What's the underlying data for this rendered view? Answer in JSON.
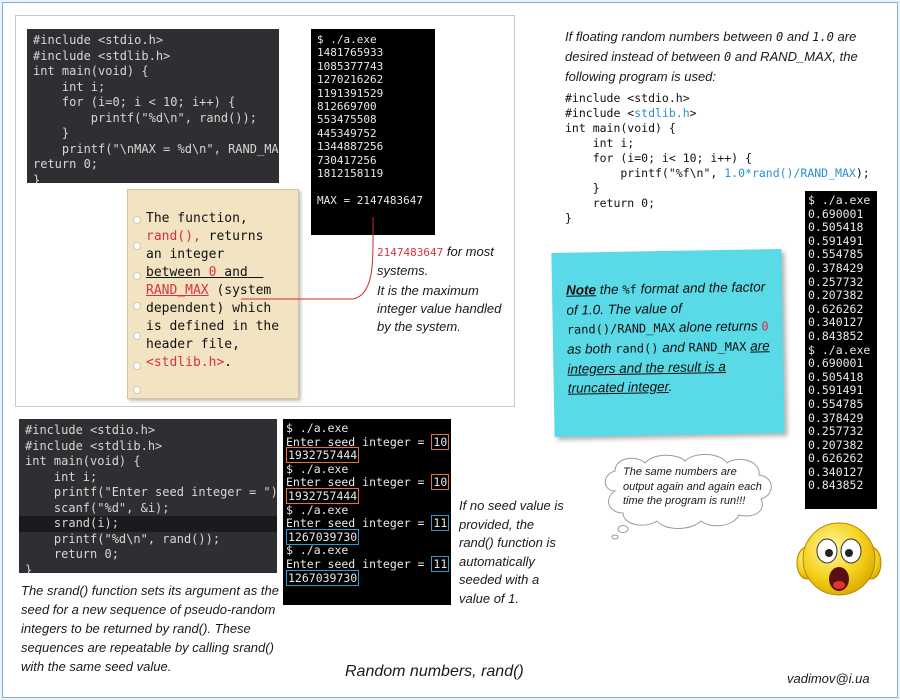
{
  "code1": {
    "lines": [
      "#include <stdio.h>",
      "#include <stdlib.h>",
      "int main(void) {",
      "    int i;",
      "    for (i=0; i < 10; i++) {",
      "        printf(\"%d\\n\", rand());",
      "    }",
      "    printf(\"\\nMAX = %d\\n\", RAND_MAX);",
      "return 0;",
      "}"
    ]
  },
  "term1": {
    "lines": [
      "$ ./a.exe",
      "1481765933",
      "1085377743",
      "1270216262",
      "1191391529",
      "812669700",
      "553475508",
      "445349752",
      "1344887256",
      "730417256",
      "1812158119",
      "",
      "MAX = 2147483647"
    ]
  },
  "note1": {
    "p1": "The function,",
    "p2": "rand(),",
    "p3": "returns",
    "p4": "an integer",
    "p5": "between",
    "p6": "0",
    "p7": "and",
    "p8": "RAND_MAX",
    "p9": "(system",
    "p10": "dependent) which",
    "p11": "is defined in the",
    "p12": "header file,",
    "p13": "<stdlib.h>",
    "p14": "."
  },
  "callout1": {
    "value": "2147483647",
    "tail": "for most systems.",
    "desc": "It is the maximum integer value handled by the system."
  },
  "intro": {
    "t1": "If floating random numbers between",
    "t2": "0",
    "t3": "and",
    "t4": "1.0",
    "t5": "are desired instead of between",
    "t6": "0",
    "t7": "and RAND_MAX, the following program is used:"
  },
  "code2": {
    "l1": "#include <stdio.h>",
    "l2a": "#include <",
    "l2b": "stdlib.h",
    "l2c": ">",
    "l3": "int main(void) {",
    "l4": "    int i;",
    "l5": "    for (i=0; i< 10; i++) {",
    "l6a": "        printf(\"%f\\n\", ",
    "l6b": "1.0*rand()/RAND_MAX",
    "l6c": ");",
    "l7": "    }",
    "l8": "    return 0;",
    "l9": "}"
  },
  "term3": {
    "lines": [
      "$ ./a.exe",
      "0.690001",
      "0.505418",
      "0.591491",
      "0.554785",
      "0.378429",
      "0.257732",
      "0.207382",
      "0.626262",
      "0.340127",
      "0.843852",
      "$ ./a.exe",
      "0.690001",
      "0.505418",
      "0.591491",
      "0.554785",
      "0.378429",
      "0.257732",
      "0.207382",
      "0.626262",
      "0.340127",
      "0.843852"
    ]
  },
  "sticky": {
    "note": "Note",
    "a": "the",
    "b": "%f",
    "c": "format and the factor of 1.0. The value of",
    "d": "rand()/RAND_MAX",
    "e": "alone returns",
    "f": "0",
    "g": "as both",
    "h": "rand()",
    "i": "and",
    "j": "RAND_MAX",
    "k": "are integers and the result is a truncated integer",
    "l": "."
  },
  "cloud": {
    "text": "The same numbers are output again and again each time the program is run!!!"
  },
  "code3": {
    "lines": [
      "#include <stdio.h>",
      "#include <stdlib.h>",
      "int main(void) {",
      "    int i;",
      "    printf(\"Enter seed integer = \");",
      "    scanf(\"%d\", &i);",
      "    srand(i);",
      "    printf(\"%d\\n\", rand());",
      "    return 0;",
      "}"
    ]
  },
  "term2": {
    "prompt": "$ ./a.exe",
    "label": "Enter seed integer = ",
    "runs": [
      {
        "seed": "10",
        "out": "1932757444"
      },
      {
        "seed": "10",
        "out": "1932757444"
      },
      {
        "seed": "11",
        "out": "1267039730"
      },
      {
        "seed": "11",
        "out": "1267039730"
      }
    ]
  },
  "seedNote": {
    "text": "If no seed value is provided, the rand() function is automatically seeded with a value of 1."
  },
  "srandText": {
    "text": "The srand() function sets its argument as the seed for a new sequence of pseudo-random integers to be returned by rand(). These sequences are repeatable by calling srand() with the same seed value."
  },
  "footer": {
    "title": "Random numbers, rand()",
    "author": "vadimov@i.ua"
  },
  "colors": {
    "accent_red": "#d9323c",
    "sticky_bg": "#5ad9e6",
    "seed_box_10": "#e0733b",
    "seed_box_11": "#2d9ad8"
  }
}
